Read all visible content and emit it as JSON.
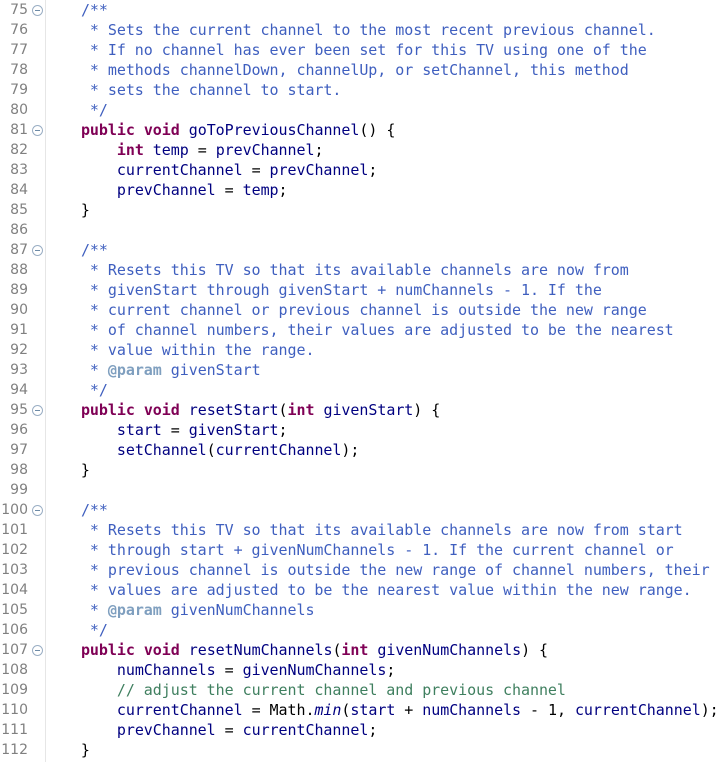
{
  "editor": {
    "name": "java-source-editor",
    "language": "Java",
    "first_line": 75,
    "last_line": 112,
    "line_height_px": 20,
    "colors": {
      "background": "#ffffff",
      "gutter_text": "#808080",
      "gutter_rule": "#e6e6e6",
      "keyword": "#7f0055",
      "javadoc": "#3f5fbf",
      "javadoc_tag": "#7f9fbf",
      "line_comment": "#3f7f5f",
      "identifier": "#000080",
      "default_text": "#000000",
      "fold_marker": "#9aaec4"
    }
  },
  "lines": [
    {
      "num": "75",
      "fold": true,
      "tokens": [
        {
          "t": "plain",
          "s": "    "
        },
        {
          "t": "jdoc",
          "s": "/**"
        }
      ]
    },
    {
      "num": "76",
      "fold": false,
      "tokens": [
        {
          "t": "jdoc",
          "s": "     * Sets the current channel to the most recent previous channel."
        }
      ]
    },
    {
      "num": "77",
      "fold": false,
      "tokens": [
        {
          "t": "jdoc",
          "s": "     * If no channel has ever been set for this TV using one of the"
        }
      ]
    },
    {
      "num": "78",
      "fold": false,
      "tokens": [
        {
          "t": "jdoc",
          "s": "     * methods channelDown, channelUp, or setChannel, this method"
        }
      ]
    },
    {
      "num": "79",
      "fold": false,
      "tokens": [
        {
          "t": "jdoc",
          "s": "     * sets the channel to start."
        }
      ]
    },
    {
      "num": "80",
      "fold": false,
      "tokens": [
        {
          "t": "jdoc",
          "s": "     */"
        }
      ]
    },
    {
      "num": "81",
      "fold": true,
      "tokens": [
        {
          "t": "plain",
          "s": "    "
        },
        {
          "t": "kw",
          "s": "public"
        },
        {
          "t": "plain",
          "s": " "
        },
        {
          "t": "kw",
          "s": "void"
        },
        {
          "t": "plain",
          "s": " "
        },
        {
          "t": "ident",
          "s": "goToPreviousChannel"
        },
        {
          "t": "plain",
          "s": "() {"
        }
      ]
    },
    {
      "num": "82",
      "fold": false,
      "tokens": [
        {
          "t": "plain",
          "s": "        "
        },
        {
          "t": "kw",
          "s": "int"
        },
        {
          "t": "plain",
          "s": " "
        },
        {
          "t": "ident",
          "s": "temp"
        },
        {
          "t": "plain",
          "s": " = "
        },
        {
          "t": "ident",
          "s": "prevChannel"
        },
        {
          "t": "plain",
          "s": ";"
        }
      ]
    },
    {
      "num": "83",
      "fold": false,
      "tokens": [
        {
          "t": "plain",
          "s": "        "
        },
        {
          "t": "ident",
          "s": "currentChannel"
        },
        {
          "t": "plain",
          "s": " = "
        },
        {
          "t": "ident",
          "s": "prevChannel"
        },
        {
          "t": "plain",
          "s": ";"
        }
      ]
    },
    {
      "num": "84",
      "fold": false,
      "tokens": [
        {
          "t": "plain",
          "s": "        "
        },
        {
          "t": "ident",
          "s": "prevChannel"
        },
        {
          "t": "plain",
          "s": " = "
        },
        {
          "t": "ident",
          "s": "temp"
        },
        {
          "t": "plain",
          "s": ";"
        }
      ]
    },
    {
      "num": "85",
      "fold": false,
      "tokens": [
        {
          "t": "plain",
          "s": "    }"
        }
      ]
    },
    {
      "num": "86",
      "fold": false,
      "tokens": [
        {
          "t": "plain",
          "s": ""
        }
      ]
    },
    {
      "num": "87",
      "fold": true,
      "tokens": [
        {
          "t": "plain",
          "s": "    "
        },
        {
          "t": "jdoc",
          "s": "/**"
        }
      ]
    },
    {
      "num": "88",
      "fold": false,
      "tokens": [
        {
          "t": "jdoc",
          "s": "     * Resets this TV so that its available channels are now from"
        }
      ]
    },
    {
      "num": "89",
      "fold": false,
      "tokens": [
        {
          "t": "jdoc",
          "s": "     * givenStart through givenStart + numChannels - 1. If the"
        }
      ]
    },
    {
      "num": "90",
      "fold": false,
      "tokens": [
        {
          "t": "jdoc",
          "s": "     * current channel or previous channel is outside the new range"
        }
      ]
    },
    {
      "num": "91",
      "fold": false,
      "tokens": [
        {
          "t": "jdoc",
          "s": "     * of channel numbers, their values are adjusted to be the nearest"
        }
      ]
    },
    {
      "num": "92",
      "fold": false,
      "tokens": [
        {
          "t": "jdoc",
          "s": "     * value within the range."
        }
      ]
    },
    {
      "num": "93",
      "fold": false,
      "tokens": [
        {
          "t": "jdoc",
          "s": "     * "
        },
        {
          "t": "jtag",
          "s": "@param"
        },
        {
          "t": "jdoc",
          "s": " givenStart"
        }
      ]
    },
    {
      "num": "94",
      "fold": false,
      "tokens": [
        {
          "t": "jdoc",
          "s": "     */"
        }
      ]
    },
    {
      "num": "95",
      "fold": true,
      "tokens": [
        {
          "t": "plain",
          "s": "    "
        },
        {
          "t": "kw",
          "s": "public"
        },
        {
          "t": "plain",
          "s": " "
        },
        {
          "t": "kw",
          "s": "void"
        },
        {
          "t": "plain",
          "s": " "
        },
        {
          "t": "ident",
          "s": "resetStart"
        },
        {
          "t": "plain",
          "s": "("
        },
        {
          "t": "kw",
          "s": "int"
        },
        {
          "t": "plain",
          "s": " "
        },
        {
          "t": "ident",
          "s": "givenStart"
        },
        {
          "t": "plain",
          "s": ") {"
        }
      ]
    },
    {
      "num": "96",
      "fold": false,
      "tokens": [
        {
          "t": "plain",
          "s": "        "
        },
        {
          "t": "ident",
          "s": "start"
        },
        {
          "t": "plain",
          "s": " = "
        },
        {
          "t": "ident",
          "s": "givenStart"
        },
        {
          "t": "plain",
          "s": ";"
        }
      ]
    },
    {
      "num": "97",
      "fold": false,
      "tokens": [
        {
          "t": "plain",
          "s": "        "
        },
        {
          "t": "ident",
          "s": "setChannel"
        },
        {
          "t": "plain",
          "s": "("
        },
        {
          "t": "ident",
          "s": "currentChannel"
        },
        {
          "t": "plain",
          "s": ");"
        }
      ]
    },
    {
      "num": "98",
      "fold": false,
      "tokens": [
        {
          "t": "plain",
          "s": "    }"
        }
      ]
    },
    {
      "num": "99",
      "fold": false,
      "tokens": [
        {
          "t": "plain",
          "s": ""
        }
      ]
    },
    {
      "num": "100",
      "fold": true,
      "tokens": [
        {
          "t": "plain",
          "s": "    "
        },
        {
          "t": "jdoc",
          "s": "/**"
        }
      ]
    },
    {
      "num": "101",
      "fold": false,
      "tokens": [
        {
          "t": "jdoc",
          "s": "     * Resets this TV so that its available channels are now from start"
        }
      ]
    },
    {
      "num": "102",
      "fold": false,
      "tokens": [
        {
          "t": "jdoc",
          "s": "     * through start + givenNumChannels - 1. If the current channel or"
        }
      ]
    },
    {
      "num": "103",
      "fold": false,
      "tokens": [
        {
          "t": "jdoc",
          "s": "     * previous channel is outside the new range of channel numbers, their"
        }
      ]
    },
    {
      "num": "104",
      "fold": false,
      "tokens": [
        {
          "t": "jdoc",
          "s": "     * values are adjusted to be the nearest value within the new range."
        }
      ]
    },
    {
      "num": "105",
      "fold": false,
      "tokens": [
        {
          "t": "jdoc",
          "s": "     * "
        },
        {
          "t": "jtag",
          "s": "@param"
        },
        {
          "t": "jdoc",
          "s": " givenNumChannels"
        }
      ]
    },
    {
      "num": "106",
      "fold": false,
      "tokens": [
        {
          "t": "jdoc",
          "s": "     */"
        }
      ]
    },
    {
      "num": "107",
      "fold": true,
      "tokens": [
        {
          "t": "plain",
          "s": "    "
        },
        {
          "t": "kw",
          "s": "public"
        },
        {
          "t": "plain",
          "s": " "
        },
        {
          "t": "kw",
          "s": "void"
        },
        {
          "t": "plain",
          "s": " "
        },
        {
          "t": "ident",
          "s": "resetNumChannels"
        },
        {
          "t": "plain",
          "s": "("
        },
        {
          "t": "kw",
          "s": "int"
        },
        {
          "t": "plain",
          "s": " "
        },
        {
          "t": "ident",
          "s": "givenNumChannels"
        },
        {
          "t": "plain",
          "s": ") {"
        }
      ]
    },
    {
      "num": "108",
      "fold": false,
      "tokens": [
        {
          "t": "plain",
          "s": "        "
        },
        {
          "t": "ident",
          "s": "numChannels"
        },
        {
          "t": "plain",
          "s": " = "
        },
        {
          "t": "ident",
          "s": "givenNumChannels"
        },
        {
          "t": "plain",
          "s": ";"
        }
      ]
    },
    {
      "num": "109",
      "fold": false,
      "tokens": [
        {
          "t": "plain",
          "s": "        "
        },
        {
          "t": "cmt",
          "s": "// adjust the current channel and previous channel"
        }
      ]
    },
    {
      "num": "110",
      "fold": false,
      "tokens": [
        {
          "t": "plain",
          "s": "        "
        },
        {
          "t": "ident",
          "s": "currentChannel"
        },
        {
          "t": "plain",
          "s": " = "
        },
        {
          "t": "plain",
          "s": "Math."
        },
        {
          "t": "stat",
          "s": "min"
        },
        {
          "t": "plain",
          "s": "("
        },
        {
          "t": "ident",
          "s": "start"
        },
        {
          "t": "plain",
          "s": " + "
        },
        {
          "t": "ident",
          "s": "numChannels"
        },
        {
          "t": "plain",
          "s": " - "
        },
        {
          "t": "num",
          "s": "1"
        },
        {
          "t": "plain",
          "s": ", "
        },
        {
          "t": "ident",
          "s": "currentChannel"
        },
        {
          "t": "plain",
          "s": ");"
        }
      ]
    },
    {
      "num": "111",
      "fold": false,
      "tokens": [
        {
          "t": "plain",
          "s": "        "
        },
        {
          "t": "ident",
          "s": "prevChannel"
        },
        {
          "t": "plain",
          "s": " = "
        },
        {
          "t": "ident",
          "s": "currentChannel"
        },
        {
          "t": "plain",
          "s": ";"
        }
      ]
    },
    {
      "num": "112",
      "fold": false,
      "tokens": [
        {
          "t": "plain",
          "s": "    }"
        }
      ]
    }
  ]
}
